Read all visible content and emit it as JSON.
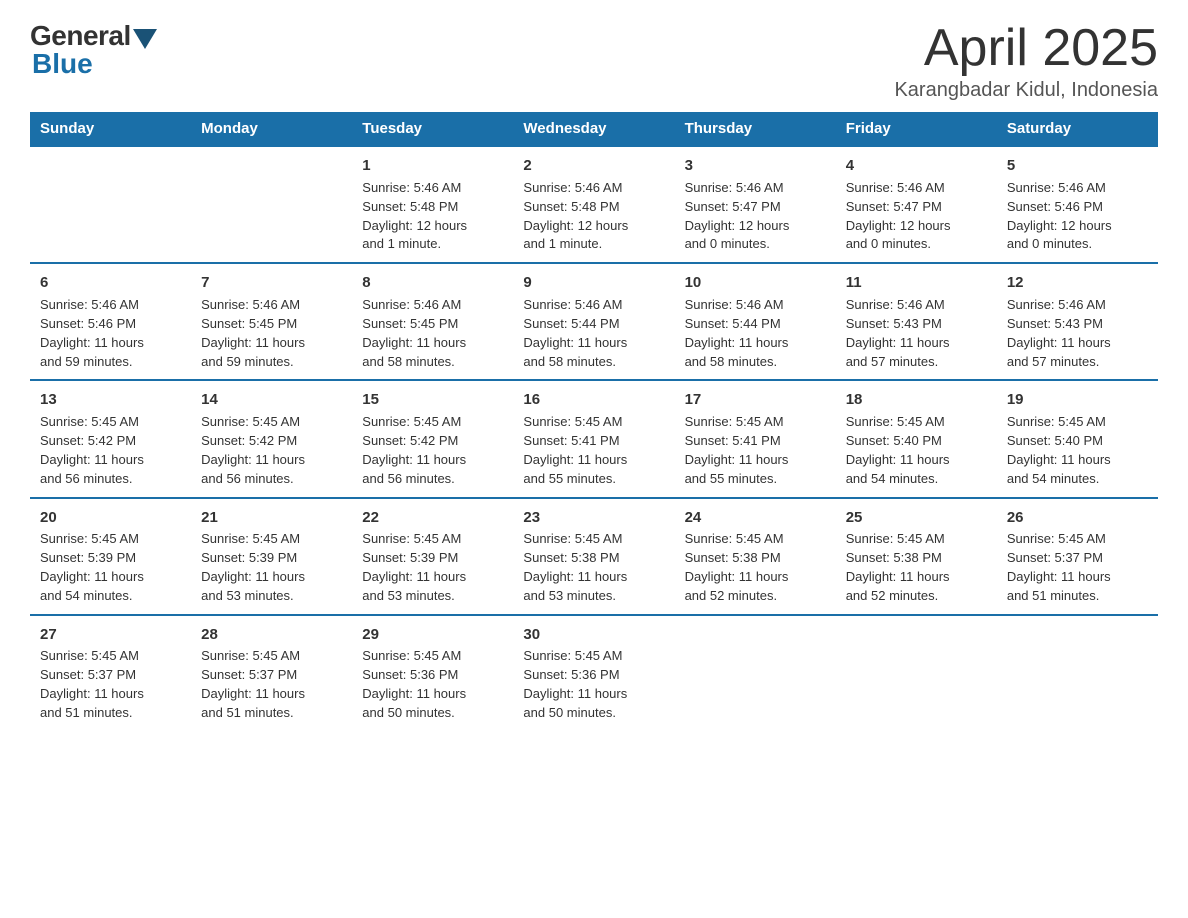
{
  "header": {
    "logo": {
      "general": "General",
      "blue": "Blue",
      "tagline": "GeneralBlue"
    },
    "title": "April 2025",
    "location": "Karangbadar Kidul, Indonesia"
  },
  "weekdays": [
    "Sunday",
    "Monday",
    "Tuesday",
    "Wednesday",
    "Thursday",
    "Friday",
    "Saturday"
  ],
  "weeks": [
    [
      {
        "day": "",
        "info": ""
      },
      {
        "day": "",
        "info": ""
      },
      {
        "day": "1",
        "info": "Sunrise: 5:46 AM\nSunset: 5:48 PM\nDaylight: 12 hours\nand 1 minute."
      },
      {
        "day": "2",
        "info": "Sunrise: 5:46 AM\nSunset: 5:48 PM\nDaylight: 12 hours\nand 1 minute."
      },
      {
        "day": "3",
        "info": "Sunrise: 5:46 AM\nSunset: 5:47 PM\nDaylight: 12 hours\nand 0 minutes."
      },
      {
        "day": "4",
        "info": "Sunrise: 5:46 AM\nSunset: 5:47 PM\nDaylight: 12 hours\nand 0 minutes."
      },
      {
        "day": "5",
        "info": "Sunrise: 5:46 AM\nSunset: 5:46 PM\nDaylight: 12 hours\nand 0 minutes."
      }
    ],
    [
      {
        "day": "6",
        "info": "Sunrise: 5:46 AM\nSunset: 5:46 PM\nDaylight: 11 hours\nand 59 minutes."
      },
      {
        "day": "7",
        "info": "Sunrise: 5:46 AM\nSunset: 5:45 PM\nDaylight: 11 hours\nand 59 minutes."
      },
      {
        "day": "8",
        "info": "Sunrise: 5:46 AM\nSunset: 5:45 PM\nDaylight: 11 hours\nand 58 minutes."
      },
      {
        "day": "9",
        "info": "Sunrise: 5:46 AM\nSunset: 5:44 PM\nDaylight: 11 hours\nand 58 minutes."
      },
      {
        "day": "10",
        "info": "Sunrise: 5:46 AM\nSunset: 5:44 PM\nDaylight: 11 hours\nand 58 minutes."
      },
      {
        "day": "11",
        "info": "Sunrise: 5:46 AM\nSunset: 5:43 PM\nDaylight: 11 hours\nand 57 minutes."
      },
      {
        "day": "12",
        "info": "Sunrise: 5:46 AM\nSunset: 5:43 PM\nDaylight: 11 hours\nand 57 minutes."
      }
    ],
    [
      {
        "day": "13",
        "info": "Sunrise: 5:45 AM\nSunset: 5:42 PM\nDaylight: 11 hours\nand 56 minutes."
      },
      {
        "day": "14",
        "info": "Sunrise: 5:45 AM\nSunset: 5:42 PM\nDaylight: 11 hours\nand 56 minutes."
      },
      {
        "day": "15",
        "info": "Sunrise: 5:45 AM\nSunset: 5:42 PM\nDaylight: 11 hours\nand 56 minutes."
      },
      {
        "day": "16",
        "info": "Sunrise: 5:45 AM\nSunset: 5:41 PM\nDaylight: 11 hours\nand 55 minutes."
      },
      {
        "day": "17",
        "info": "Sunrise: 5:45 AM\nSunset: 5:41 PM\nDaylight: 11 hours\nand 55 minutes."
      },
      {
        "day": "18",
        "info": "Sunrise: 5:45 AM\nSunset: 5:40 PM\nDaylight: 11 hours\nand 54 minutes."
      },
      {
        "day": "19",
        "info": "Sunrise: 5:45 AM\nSunset: 5:40 PM\nDaylight: 11 hours\nand 54 minutes."
      }
    ],
    [
      {
        "day": "20",
        "info": "Sunrise: 5:45 AM\nSunset: 5:39 PM\nDaylight: 11 hours\nand 54 minutes."
      },
      {
        "day": "21",
        "info": "Sunrise: 5:45 AM\nSunset: 5:39 PM\nDaylight: 11 hours\nand 53 minutes."
      },
      {
        "day": "22",
        "info": "Sunrise: 5:45 AM\nSunset: 5:39 PM\nDaylight: 11 hours\nand 53 minutes."
      },
      {
        "day": "23",
        "info": "Sunrise: 5:45 AM\nSunset: 5:38 PM\nDaylight: 11 hours\nand 53 minutes."
      },
      {
        "day": "24",
        "info": "Sunrise: 5:45 AM\nSunset: 5:38 PM\nDaylight: 11 hours\nand 52 minutes."
      },
      {
        "day": "25",
        "info": "Sunrise: 5:45 AM\nSunset: 5:38 PM\nDaylight: 11 hours\nand 52 minutes."
      },
      {
        "day": "26",
        "info": "Sunrise: 5:45 AM\nSunset: 5:37 PM\nDaylight: 11 hours\nand 51 minutes."
      }
    ],
    [
      {
        "day": "27",
        "info": "Sunrise: 5:45 AM\nSunset: 5:37 PM\nDaylight: 11 hours\nand 51 minutes."
      },
      {
        "day": "28",
        "info": "Sunrise: 5:45 AM\nSunset: 5:37 PM\nDaylight: 11 hours\nand 51 minutes."
      },
      {
        "day": "29",
        "info": "Sunrise: 5:45 AM\nSunset: 5:36 PM\nDaylight: 11 hours\nand 50 minutes."
      },
      {
        "day": "30",
        "info": "Sunrise: 5:45 AM\nSunset: 5:36 PM\nDaylight: 11 hours\nand 50 minutes."
      },
      {
        "day": "",
        "info": ""
      },
      {
        "day": "",
        "info": ""
      },
      {
        "day": "",
        "info": ""
      }
    ]
  ]
}
